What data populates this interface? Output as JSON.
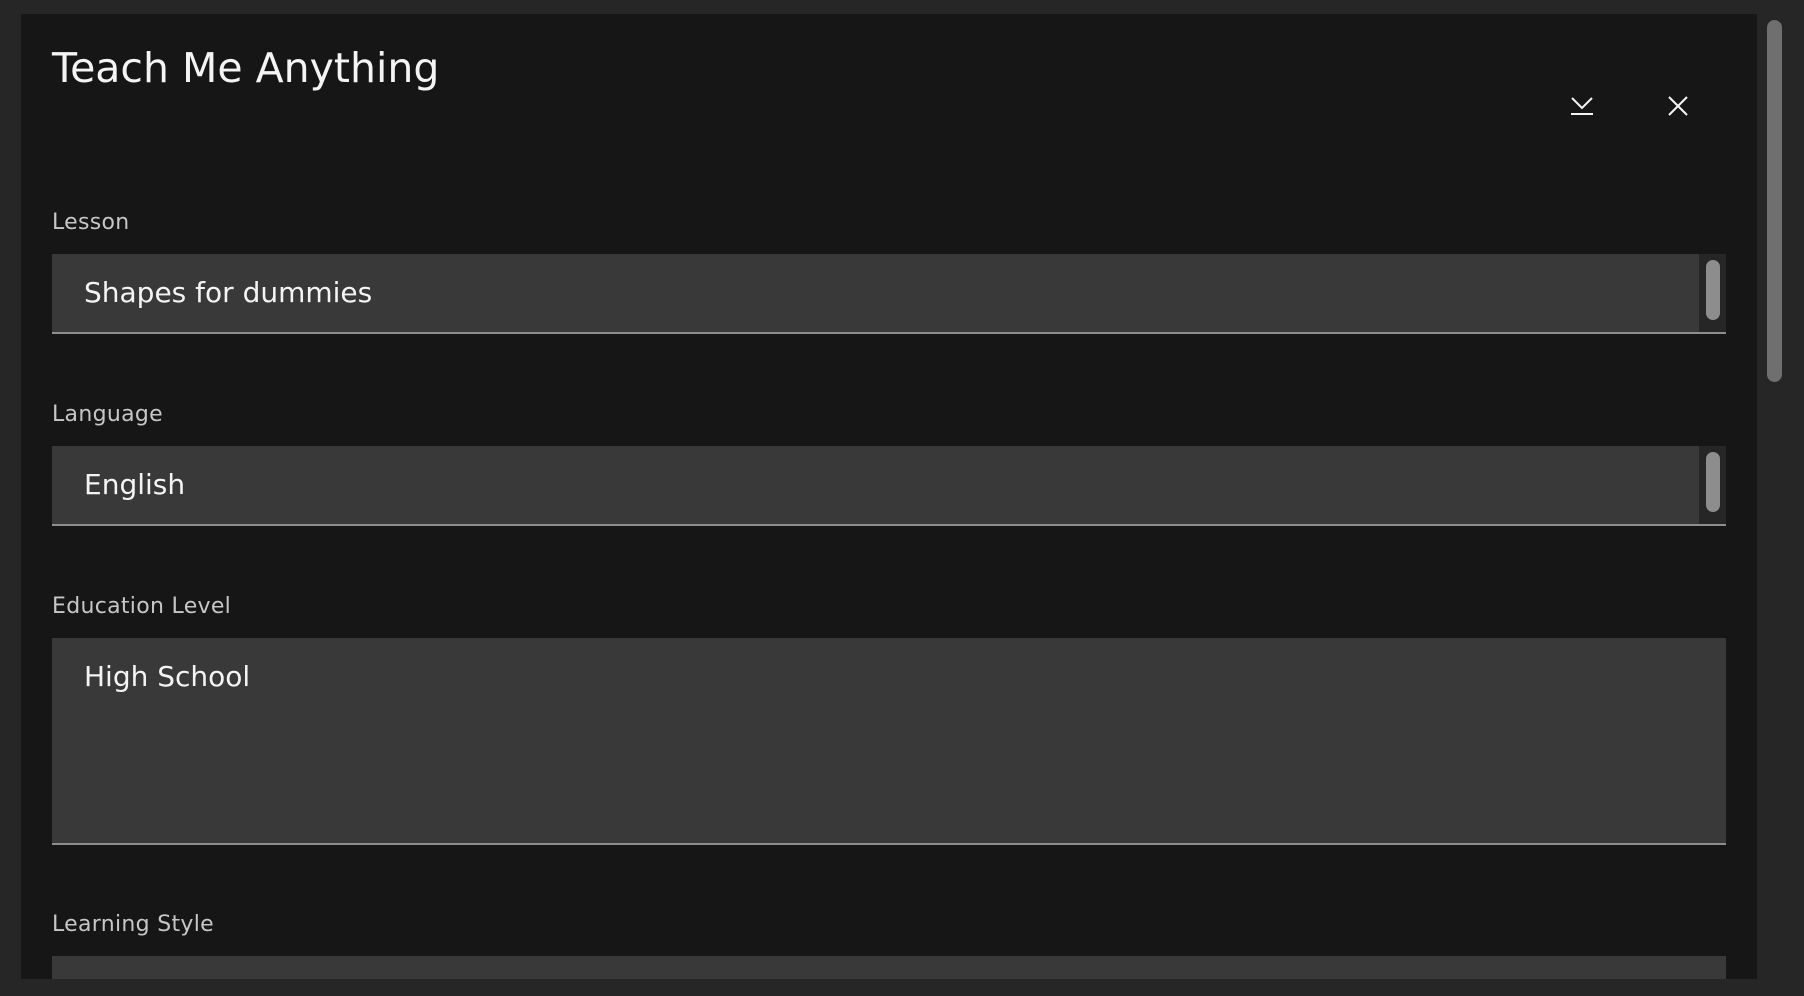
{
  "dialog": {
    "title": "Teach Me Anything",
    "collapse_icon": "collapse-download-icon",
    "close_icon": "close-icon"
  },
  "fields": {
    "lesson": {
      "label": "Lesson",
      "value": "Shapes for dummies"
    },
    "language": {
      "label": "Language",
      "value": "English"
    },
    "education_level": {
      "label": "Education Level",
      "value": "High School"
    },
    "learning_style": {
      "label": "Learning Style",
      "value": ""
    }
  },
  "colors": {
    "background": "#262626",
    "panel": "#161616",
    "field": "#393939",
    "text": "#f4f4f4",
    "label": "#c6c6c6"
  }
}
